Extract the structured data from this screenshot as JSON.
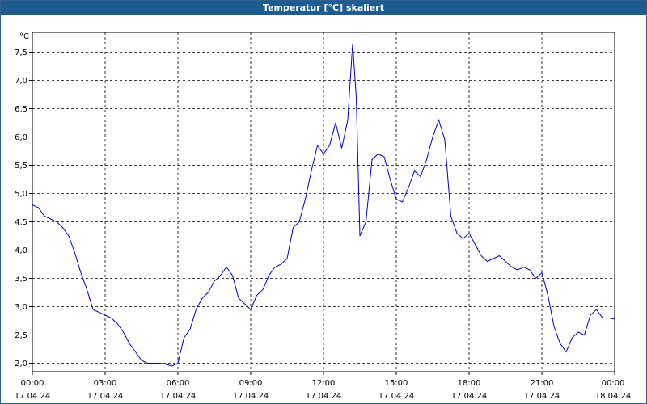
{
  "window": {
    "title": "Temperatur [°C] skaliert"
  },
  "chart_data": {
    "type": "line",
    "title": "Temperatur [°C] skaliert",
    "ylabel": "°C",
    "xlabel": "",
    "ylim": [
      1.85,
      7.85
    ],
    "y_ticks": [
      "2,0",
      "2,5",
      "3,0",
      "3,5",
      "4,0",
      "4,5",
      "5,0",
      "5,5",
      "6,0",
      "6,5",
      "7,0",
      "7,5"
    ],
    "y_tick_values": [
      2.0,
      2.5,
      3.0,
      3.5,
      4.0,
      4.5,
      5.0,
      5.5,
      6.0,
      6.5,
      7.0,
      7.5
    ],
    "x_ticks": [
      {
        "time": "00:00",
        "date": "17.04.24"
      },
      {
        "time": "03:00",
        "date": "17.04.24"
      },
      {
        "time": "06:00",
        "date": "17.04.24"
      },
      {
        "time": "09:00",
        "date": "17.04.24"
      },
      {
        "time": "12:00",
        "date": "17.04.24"
      },
      {
        "time": "15:00",
        "date": "17.04.24"
      },
      {
        "time": "18:00",
        "date": "17.04.24"
      },
      {
        "time": "21:00",
        "date": "17.04.24"
      },
      {
        "time": "00:00",
        "date": "18.04.24"
      }
    ],
    "x_tick_values": [
      0,
      3,
      6,
      9,
      12,
      15,
      18,
      21,
      24
    ],
    "x_unit": "hours",
    "grid": true,
    "line_color": "#0000cc",
    "series": [
      {
        "x": [
          0,
          0.25,
          0.5,
          0.75,
          1.0,
          1.25,
          1.5,
          1.75,
          2.0,
          2.25,
          2.5,
          2.75,
          3.0,
          3.25,
          3.5,
          3.75,
          4.0,
          4.25,
          4.5,
          4.75,
          5.0,
          5.25,
          5.5,
          5.75,
          6.0,
          6.25,
          6.5,
          6.75,
          7.0,
          7.25,
          7.5,
          7.75,
          8.0,
          8.25,
          8.5,
          8.75,
          9.0,
          9.25,
          9.5,
          9.75,
          10.0,
          10.25,
          10.5,
          10.75,
          11.0,
          11.25,
          11.5,
          11.75,
          12.0,
          12.25,
          12.5,
          12.75,
          13.0,
          13.2,
          13.35,
          13.5,
          13.75,
          14.0,
          14.25,
          14.5,
          14.75,
          15.0,
          15.25,
          15.5,
          15.75,
          16.0,
          16.25,
          16.5,
          16.75,
          17.0,
          17.25,
          17.5,
          17.75,
          18.0,
          18.25,
          18.5,
          18.75,
          19.0,
          19.25,
          19.5,
          19.75,
          20.0,
          20.25,
          20.5,
          20.75,
          21.0,
          21.25,
          21.5,
          21.75,
          22.0,
          22.25,
          22.5,
          22.75,
          23.0,
          23.25,
          23.5,
          23.75,
          24.0
        ],
        "y": [
          4.8,
          4.75,
          4.6,
          4.55,
          4.5,
          4.4,
          4.25,
          3.95,
          3.6,
          3.3,
          2.95,
          2.9,
          2.85,
          2.8,
          2.7,
          2.55,
          2.35,
          2.2,
          2.05,
          2.0,
          2.0,
          2.0,
          1.98,
          1.95,
          2.0,
          2.45,
          2.6,
          2.95,
          3.15,
          3.25,
          3.45,
          3.55,
          3.7,
          3.55,
          3.15,
          3.05,
          2.95,
          3.2,
          3.3,
          3.55,
          3.7,
          3.75,
          3.85,
          4.4,
          4.5,
          4.9,
          5.4,
          5.85,
          5.7,
          5.85,
          6.25,
          5.8,
          6.3,
          7.65,
          6.7,
          4.25,
          4.5,
          5.6,
          5.7,
          5.65,
          5.25,
          4.9,
          4.85,
          5.1,
          5.4,
          5.3,
          5.6,
          6.0,
          6.3,
          5.95,
          4.6,
          4.3,
          4.2,
          4.3,
          4.1,
          3.9,
          3.8,
          3.85,
          3.9,
          3.8,
          3.7,
          3.65,
          3.7,
          3.65,
          3.5,
          3.6,
          3.2,
          2.65,
          2.35,
          2.2,
          2.45,
          2.55,
          2.5,
          2.85,
          2.95,
          2.8,
          2.8,
          2.78
        ]
      }
    ]
  }
}
